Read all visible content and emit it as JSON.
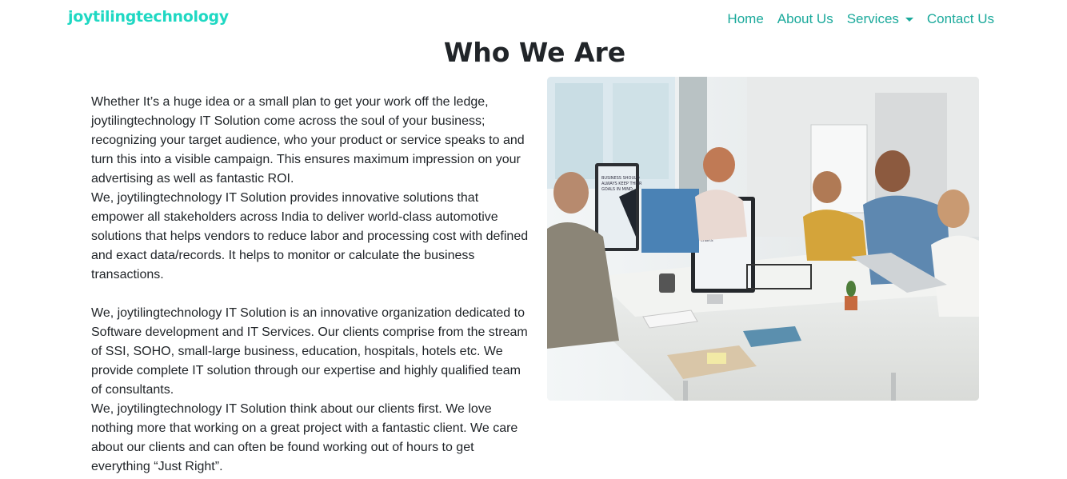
{
  "navbar": {
    "brand": "joytilingtechnology",
    "links": {
      "home": "Home",
      "about": "About Us",
      "services": "Services",
      "contact": "Contact Us"
    }
  },
  "main": {
    "title": "Who We Are",
    "paragraphs": [
      "Whether It’s a huge idea or a small plan to get your work off the ledge, joytilingtechnology IT Solution come across the soul of your business; recognizing your target audience, who your product or service speaks to and turn this into a visible campaign. This ensures maximum impression on your advertising as well as fantastic ROI.",
      "We, joytilingtechnology IT Solution provides innovative solutions that empower all stakeholders across India to deliver world-class automotive solutions that helps vendors to reduce labor and processing cost with defined and exact data/records. It helps to monitor or calculate the business transactions.",
      "We, joytilingtechnology IT Solution is an innovative organization dedicated to Software development and IT Services. Our clients comprise from the stream of SSI, SOHO, small-large business, education, hospitals, hotels etc. We provide complete IT solution through our expertise and highly qualified team of consultants.",
      "We, joytilingtechnology IT Solution think about our clients first. We love nothing more that working on a great project with a fantastic client. We care about our clients and can often be found working out of hours to get everything “Just Right”."
    ],
    "image": {
      "alt": "Team working at computers in a bright office",
      "screen_texts": [
        "BUSINESS SHOULD ALWAYS KEEP THEIR GOALS IN MIND",
        "Use relevant charts and graphs"
      ]
    }
  },
  "colors": {
    "brand": "#1fd8c3",
    "nav_link": "#1aa99b",
    "text": "#212529"
  }
}
